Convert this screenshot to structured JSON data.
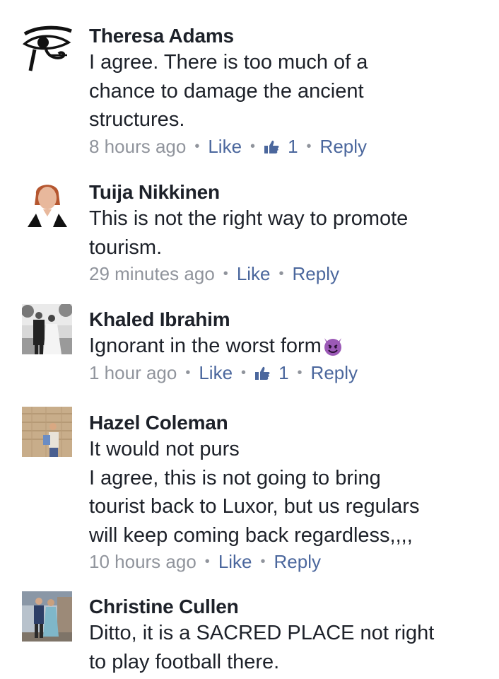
{
  "comments": [
    {
      "author": "Theresa Adams",
      "avatar_icon": "eye-of-horus-icon",
      "lines": [
        "I agree. There is too much of a",
        "chance to damage the ancient",
        "structures."
      ],
      "time": "8 hours ago",
      "like_label": "Like",
      "like_count": "1",
      "reply_label": "Reply"
    },
    {
      "author": "Tuija Nikkinen",
      "avatar_icon": "profile-photo-woman",
      "lines": [
        "This is not the right way to promote",
        "tourism."
      ],
      "time": "29 minutes ago",
      "like_label": "Like",
      "reply_label": "Reply"
    },
    {
      "author": "Khaled Ibrahim",
      "avatar_icon": "profile-photo-wedding-couple",
      "lines": [
        "Ignorant in the worst form"
      ],
      "emoji": "smiling-imp-emoji",
      "time": "1 hour ago",
      "like_label": "Like",
      "like_count": "1",
      "reply_label": "Reply"
    },
    {
      "author": "Hazel Coleman",
      "avatar_icon": "profile-photo-woman-at-temple",
      "lines": [
        "It would not purs",
        "I agree, this is not going to bring",
        "tourist back to Luxor, but us regulars",
        "will keep coming back regardless,,,,"
      ],
      "time": "10 hours ago",
      "like_label": "Like",
      "reply_label": "Reply"
    },
    {
      "author": "Christine Cullen",
      "avatar_icon": "profile-photo-couple",
      "lines": [
        "Ditto, it is a SACRED PLACE not right",
        "to play football there."
      ]
    }
  ],
  "colors": {
    "author": "#1d2129",
    "text": "#1d2129",
    "meta": "#90949c",
    "link": "#4b679d",
    "emoji": "#9b59b6"
  }
}
